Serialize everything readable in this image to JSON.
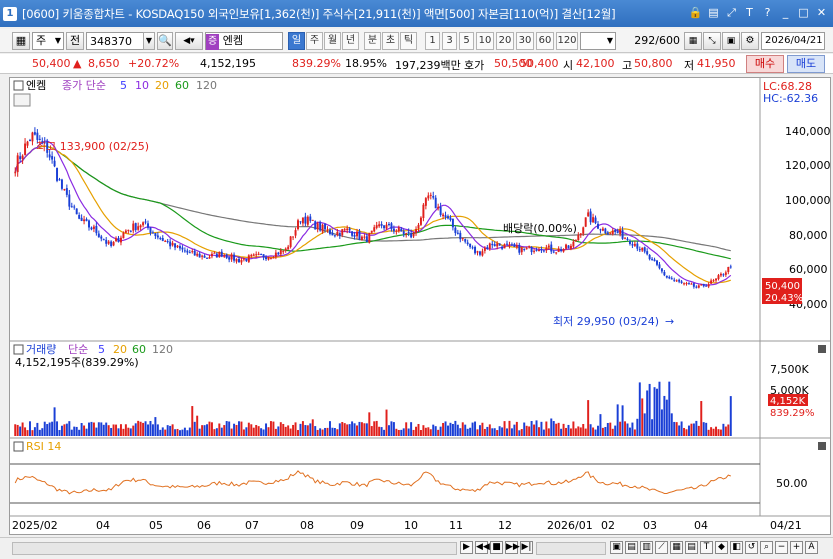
{
  "window": {
    "app_icon": "1",
    "title": "[0600] 키움종합차트 - KOSDAQ150 외국인보유[1,362(천)] 주식수[21,911(천)] 액면[500] 자본금[110(억)] 결산[12월]",
    "buttons": [
      "🔒",
      "▤",
      "⤢",
      "T",
      "?",
      "_",
      "□",
      "✕"
    ]
  },
  "toolbar": {
    "period_select": "주",
    "all_label": "전",
    "code_value": "348370",
    "stock_name": "엔켐",
    "stock_badge": "증",
    "timeframes": [
      "일",
      "주",
      "월",
      "년",
      "분",
      "초",
      "틱"
    ],
    "active_timeframe": "일",
    "minute_intervals": [
      "1",
      "3",
      "5",
      "10",
      "20",
      "30",
      "60",
      "120"
    ],
    "count_value": "292",
    "count_total": "/600",
    "date_value": "2026/04/21"
  },
  "quote": {
    "price": "50,400",
    "change": "8,650",
    "change_pct": "+20.72%",
    "volume": "4,152,195",
    "volume_ratio": "839.29%",
    "turnover": "18.95%",
    "amount": "197,239백만",
    "ask_label": "호가",
    "ask": "50,500",
    "bid": "50,400",
    "open_label": "시",
    "open": "42,100",
    "high_label": "고",
    "high": "50,800",
    "low_label": "저",
    "low": "41,950",
    "buy_label": "매수",
    "sell_label": "매도"
  },
  "price_panel": {
    "name_tag": "엔켐",
    "ma_label": "종가 단순",
    "ma_periods": [
      "5",
      "10",
      "20",
      "60",
      "120"
    ],
    "lc": "LC:68.28",
    "hc": "HC:-62.36",
    "y_ticks": [
      "140,000",
      "120,000",
      "100,000",
      "80,000",
      "60,000",
      "40,000"
    ],
    "max_label": "최고 133,900 (02/25)",
    "min_label": "최저 29,950 (03/24)",
    "dividend_label": "배당락(0.00%)",
    "last_price": "50,400",
    "last_pct": "20.43%"
  },
  "volume_panel": {
    "title": "거래량",
    "ma_label": "단순",
    "ma_periods": [
      "5",
      "20",
      "60",
      "120"
    ],
    "summary": "4,152,195주(839.29%)",
    "y_ticks": [
      "7,500K",
      "5,000K"
    ],
    "last_volume": "4,152K",
    "last_pct": "839.29%"
  },
  "rsi_panel": {
    "title": "RSI 14",
    "y_tick": "50.00"
  },
  "x_axis": {
    "labels": [
      "2025/02",
      "04",
      "05",
      "06",
      "07",
      "08",
      "09",
      "10",
      "11",
      "12",
      "2026/01",
      "02",
      "03",
      "04"
    ],
    "last_date": "04/21"
  },
  "chart_data": {
    "type": "candlestick",
    "ylim": [
      20000,
      150000
    ],
    "months": [
      "2025/02",
      "04",
      "05",
      "06",
      "07",
      "08",
      "09",
      "10",
      "11",
      "12",
      "2026/01",
      "02",
      "03",
      "04"
    ],
    "key_points": [
      {
        "label": "2025/02/25 high",
        "value": 133900
      },
      {
        "label": "2026/03/24 low",
        "value": 29950
      },
      {
        "label": "2026/04/21 close",
        "value": 50400
      }
    ],
    "close_path": [
      110000,
      128000,
      120000,
      95000,
      78000,
      72000,
      62000,
      72000,
      76000,
      68000,
      62000,
      58000,
      56000,
      58000,
      54000,
      56000,
      57000,
      60000,
      80000,
      74000,
      70000,
      72000,
      66000,
      75000,
      72000,
      68000,
      92000,
      80000,
      68000,
      58000,
      64000,
      62000,
      60000,
      62000,
      60000,
      62000,
      80000,
      72000,
      70000,
      64000,
      54000,
      44000,
      40000,
      38000,
      42000,
      50400
    ],
    "ma_series": [
      {
        "name": "5",
        "color": "#3c3cff"
      },
      {
        "name": "10",
        "color": "#8a2be2"
      },
      {
        "name": "20",
        "color": "#e6a000"
      },
      {
        "name": "60",
        "color": "#1a9a1a"
      },
      {
        "name": "120",
        "color": "#777777"
      }
    ]
  }
}
